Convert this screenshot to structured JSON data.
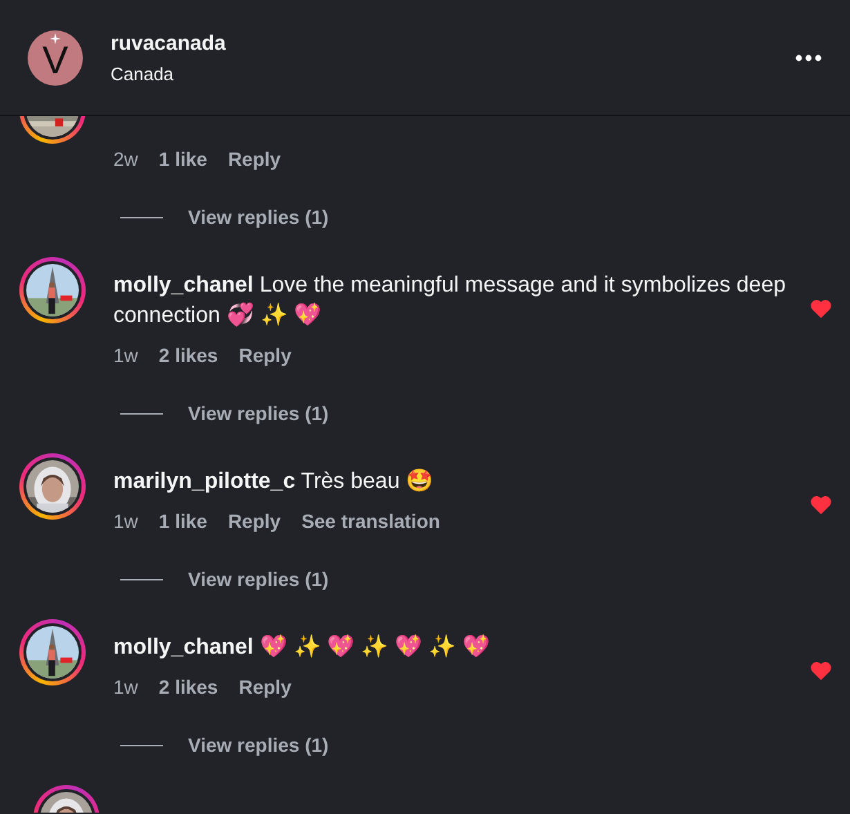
{
  "header": {
    "account": "ruvacanada",
    "location": "Canada",
    "logo_text": "V"
  },
  "comments": [
    {
      "kind": "cut_top",
      "time": "2w",
      "likes": "1 like",
      "reply": "Reply",
      "view_replies": "View replies (1)"
    },
    {
      "kind": "comment",
      "user": "molly_chanel",
      "text": "Love the meaningful message and it symbolizes deep connection 💞 ✨ 💖",
      "time": "1w",
      "likes": "2 likes",
      "reply": "Reply",
      "liked": true,
      "view_replies": "View replies (1)"
    },
    {
      "kind": "comment",
      "user": "marilyn_pilotte_c",
      "text": "Très beau 🤩",
      "time": "1w",
      "likes": "1 like",
      "reply": "Reply",
      "translate": "See translation",
      "liked": true,
      "view_replies": "View replies (1)"
    },
    {
      "kind": "comment",
      "user": "molly_chanel",
      "text": "💖 ✨ 💖 ✨ 💖 ✨ 💖",
      "time": "1w",
      "likes": "2 likes",
      "reply": "Reply",
      "liked": true,
      "view_replies": "View replies (1)"
    },
    {
      "kind": "cut_bottom"
    }
  ]
}
